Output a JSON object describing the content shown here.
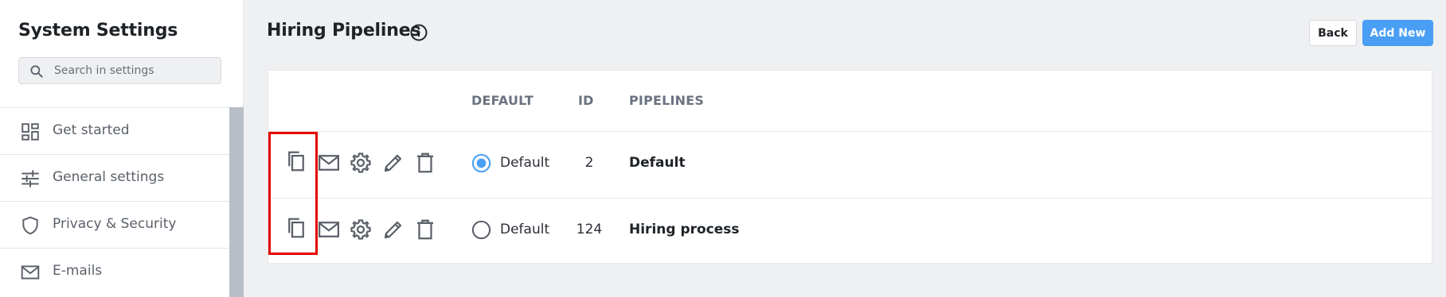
{
  "sidebar": {
    "title": "System Settings",
    "search": {
      "placeholder": "Search in settings",
      "value": "",
      "icon": "search-icon"
    },
    "items": [
      {
        "label": "Get started",
        "icon": "dashboard-icon"
      },
      {
        "label": "General settings",
        "icon": "sliders-icon"
      },
      {
        "label": "Privacy & Security",
        "icon": "shield-icon"
      },
      {
        "label": "E-mails",
        "icon": "mail-icon"
      }
    ]
  },
  "header": {
    "title": "Hiring Pipelines",
    "info_icon": "info-icon",
    "back_label": "Back",
    "add_label": "Add New"
  },
  "table": {
    "columns": [
      "DEFAULT",
      "ID",
      "PIPELINES"
    ],
    "rows": [
      {
        "default_label": "Default",
        "selected": true,
        "id": "2",
        "name": "Default"
      },
      {
        "default_label": "Default",
        "selected": false,
        "id": "124",
        "name": "Hiring process"
      }
    ],
    "actions": [
      "copy-icon",
      "mail-icon",
      "gear-icon",
      "pencil-icon",
      "trash-icon"
    ]
  },
  "colors": {
    "accent": "#4a9ff5",
    "highlight": "#e50000",
    "background": "#eff0f2",
    "scrollbar": "#b9bfc6"
  }
}
